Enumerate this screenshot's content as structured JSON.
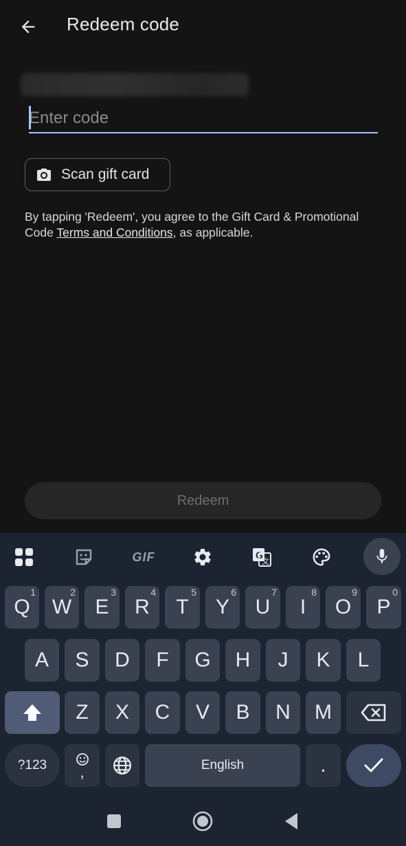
{
  "header": {
    "title": "Redeem code",
    "back_icon": "arrow-back-icon"
  },
  "code_input": {
    "placeholder": "Enter code",
    "value": ""
  },
  "scan_button": {
    "label": "Scan gift card",
    "icon": "camera-icon"
  },
  "terms": {
    "prefix": "By tapping 'Redeem', you agree to the Gift Card & Promotional Code ",
    "link": "Terms and Conditions",
    "suffix": ", as applicable."
  },
  "redeem_button": {
    "label": "Redeem",
    "enabled": false
  },
  "keyboard": {
    "toolbar": [
      "apps-grid-icon",
      "sticker-icon",
      "gif-icon",
      "settings-gear-icon",
      "translate-icon",
      "palette-icon",
      "microphone-icon"
    ],
    "toolbar_gif_label": "GIF",
    "row1": [
      {
        "key": "Q",
        "hint": "1"
      },
      {
        "key": "W",
        "hint": "2"
      },
      {
        "key": "E",
        "hint": "3"
      },
      {
        "key": "R",
        "hint": "4"
      },
      {
        "key": "T",
        "hint": "5"
      },
      {
        "key": "Y",
        "hint": "6"
      },
      {
        "key": "U",
        "hint": "7"
      },
      {
        "key": "I",
        "hint": "8"
      },
      {
        "key": "O",
        "hint": "9"
      },
      {
        "key": "P",
        "hint": "0"
      }
    ],
    "row2": [
      "A",
      "S",
      "D",
      "F",
      "G",
      "H",
      "J",
      "K",
      "L"
    ],
    "row3": [
      "Z",
      "X",
      "C",
      "V",
      "B",
      "N",
      "M"
    ],
    "symbols_label": "?123",
    "comma_label": ",",
    "space_label": "English",
    "period_label": ".",
    "accent_color": "#a9c7ff"
  },
  "navbar": {
    "icons": [
      "recents-square-icon",
      "home-circle-icon",
      "back-triangle-icon"
    ]
  }
}
